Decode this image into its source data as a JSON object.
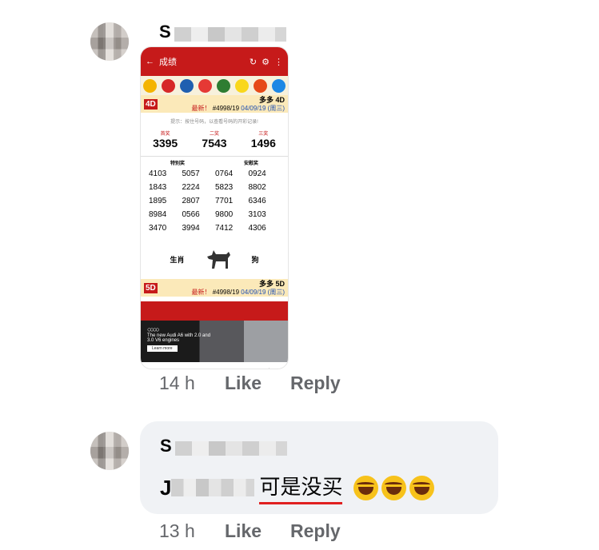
{
  "comments": [
    {
      "author_initial": "S",
      "time": "14 h",
      "like_label": "Like",
      "reply_label": "Reply",
      "attachment": {
        "app_title": "成绩",
        "game1": {
          "logo": "4D",
          "name": "多多 4D",
          "latest_label": "最新！",
          "draw_no": "#4998/19",
          "date": "04/09/19 (周三)",
          "hint": "提示：按住号码，以查看号码的开彩记录!",
          "prizes": [
            {
              "label": "首奖",
              "number": "3395"
            },
            {
              "label": "二奖",
              "number": "7543"
            },
            {
              "label": "三奖",
              "number": "1496"
            }
          ],
          "special_label": "特别奖",
          "consolation_label": "安慰奖",
          "rows": [
            [
              "4103",
              "5057",
              "0764",
              "0924"
            ],
            [
              "1843",
              "2224",
              "5823",
              "8802"
            ],
            [
              "1895",
              "2807",
              "7701",
              "6346"
            ],
            [
              "8984",
              "0566",
              "9800",
              "3103"
            ],
            [
              "3470",
              "3994",
              "7412",
              "4306"
            ]
          ],
          "zodiac_label": "生肖",
          "zodiac_value": "狗"
        },
        "game2": {
          "logo": "5D",
          "name": "多多 5D",
          "latest_label": "最新！",
          "draw_no": "#4998/19",
          "date": "04/09/19 (周三)"
        },
        "ad": {
          "text": "The new Audi A6 with 2.0 and 3.0 V6 engines",
          "button": "Learn more"
        }
      }
    },
    {
      "author_initial": "S",
      "mention_initial": "J",
      "text": "可是没买",
      "time": "13 h",
      "like_label": "Like",
      "reply_label": "Reply"
    }
  ]
}
